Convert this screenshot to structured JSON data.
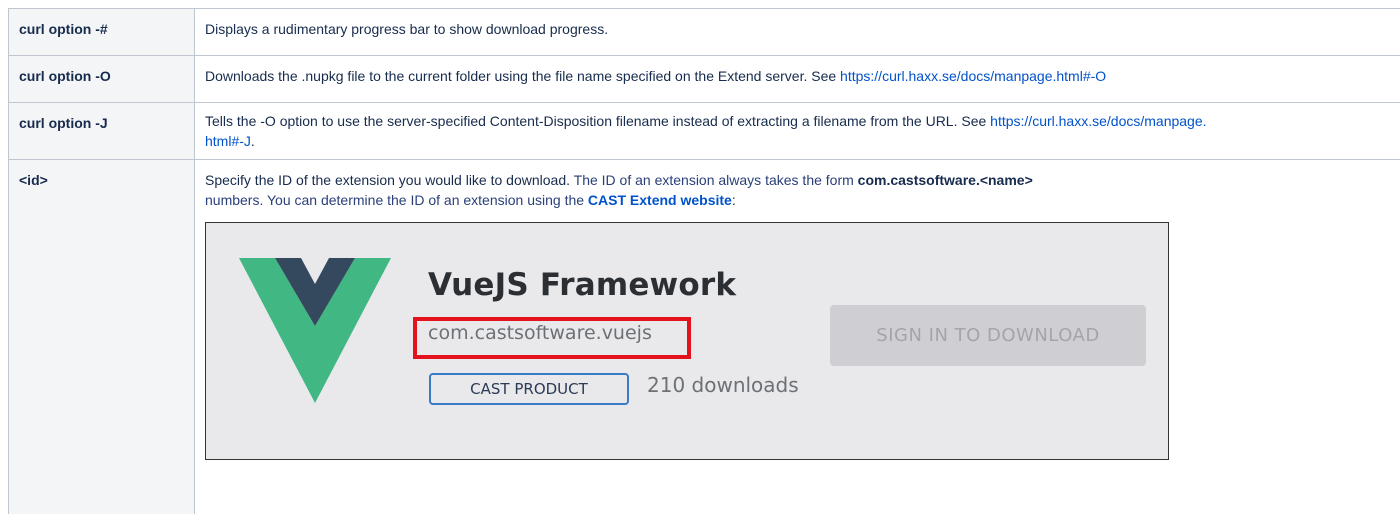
{
  "rows": [
    {
      "key": "curl option -#",
      "desc": "Displays a rudimentary progress bar to show download progress."
    },
    {
      "key": "curl option -O",
      "desc": "Downloads the .nupkg file to the current folder using the file name specified on the Extend server. See ",
      "link": "https://curl.haxx.se/docs/manpage.html#-O"
    },
    {
      "key": "curl option -J",
      "desc": "Tells the -O option to use the server-specified Content-Disposition filename instead of extracting a filename from the URL. See ",
      "link": "https://curl.haxx.se/docs/manpage.",
      "link_cont": "html#-J",
      "tail": "."
    },
    {
      "key": "<id>",
      "line1_a": "Specify the ID of the extension you would like to download. ",
      "line1_b": "The ID of an extension always takes the form ",
      "line1_c": "com.castsoftware.<name>",
      "line2_a": "numbers. You can determine the ID of an extension using the ",
      "line2_link": "CAST Extend website",
      "line2_tail": ":"
    }
  ],
  "screenshot": {
    "title": "VueJS Framework",
    "extension_id": "com.castsoftware.vuejs",
    "badge": "CAST PRODUCT",
    "downloads": "210 downloads",
    "button": "SIGN IN TO DOWNLOAD",
    "logo_icon": "vuejs-logo-icon",
    "colors": {
      "highlight": "#e4121d",
      "vue_green": "#41b883",
      "vue_dark": "#35495e",
      "link": "#0052cc"
    }
  }
}
